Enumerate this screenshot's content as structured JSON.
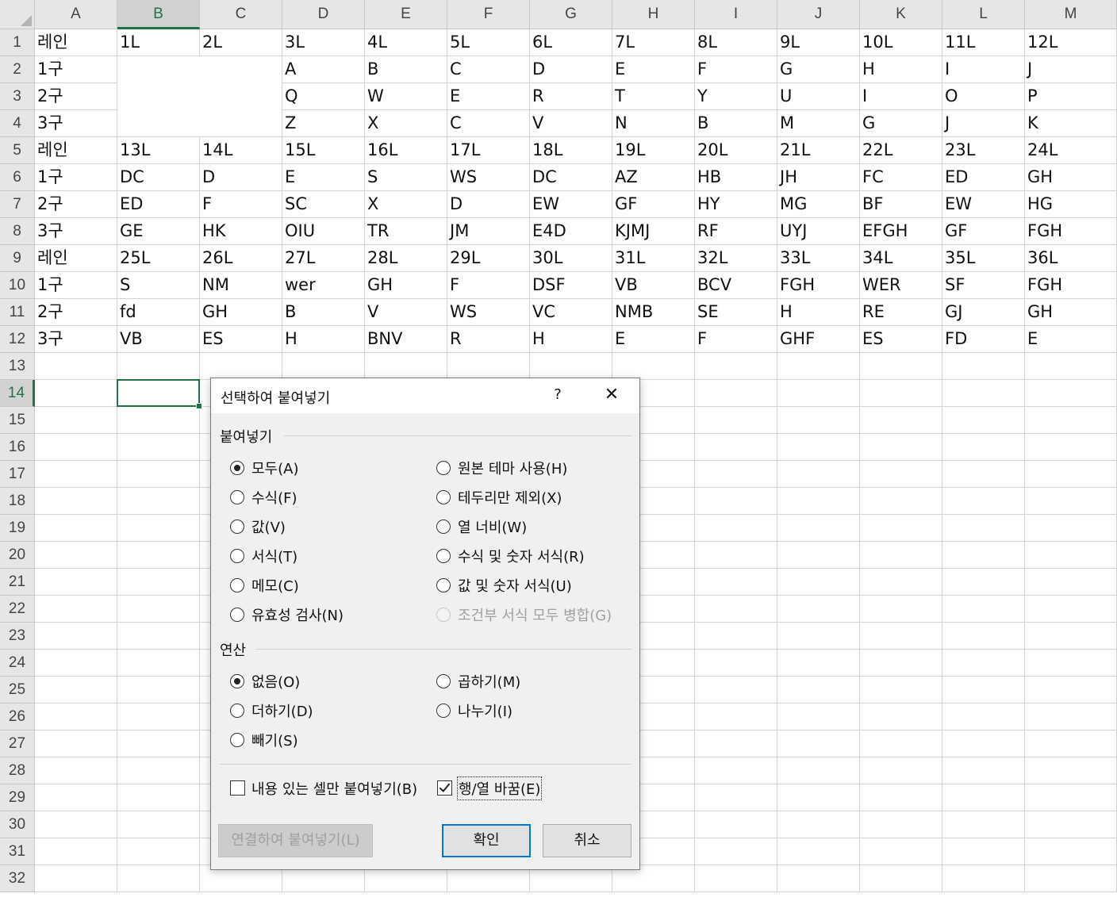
{
  "sheet": {
    "columns": [
      "A",
      "B",
      "C",
      "D",
      "E",
      "F",
      "G",
      "H",
      "I",
      "J",
      "K",
      "L",
      "M"
    ],
    "rows": [
      "1",
      "2",
      "3",
      "4",
      "5",
      "6",
      "7",
      "8",
      "9",
      "10",
      "11",
      "12",
      "13",
      "14",
      "15",
      "16",
      "17",
      "18",
      "19",
      "20",
      "21",
      "22",
      "23",
      "24",
      "25",
      "26",
      "27",
      "28",
      "29",
      "30",
      "31",
      "32"
    ],
    "selected_column": "B",
    "selected_row": "14",
    "cells": [
      [
        "레인",
        "1L",
        "2L",
        "3L",
        "4L",
        "5L",
        "6L",
        "7L",
        "8L",
        "9L",
        "10L",
        "11L",
        "12L"
      ],
      [
        "1구",
        "",
        "",
        "A",
        "B",
        "C",
        "D",
        "E",
        "F",
        "G",
        "H",
        "I",
        "J"
      ],
      [
        "2구",
        "",
        "",
        "Q",
        "W",
        "E",
        "R",
        "T",
        "Y",
        "U",
        "I",
        "O",
        "P"
      ],
      [
        "3구",
        "",
        "",
        "Z",
        "X",
        "C",
        "V",
        "N",
        "B",
        "M",
        "G",
        "J",
        "K"
      ],
      [
        "레인",
        "13L",
        "14L",
        "15L",
        "16L",
        "17L",
        "18L",
        "19L",
        "20L",
        "21L",
        "22L",
        "23L",
        "24L"
      ],
      [
        "1구",
        "DC",
        "D",
        "E",
        "S",
        "WS",
        "DC",
        "AZ",
        "HB",
        "JH",
        "FC",
        "ED",
        "GH"
      ],
      [
        "2구",
        "ED",
        "F",
        "SC",
        "X",
        "D",
        "EW",
        "GF",
        "HY",
        "MG",
        "BF",
        "EW",
        "HG"
      ],
      [
        "3구",
        "GE",
        "HK",
        "OIU",
        "TR",
        "JM",
        "E4D",
        "KJMJ",
        "RF",
        "UYJ",
        "EFGH",
        "GF",
        "FGH"
      ],
      [
        "레인",
        "25L",
        "26L",
        "27L",
        "28L",
        "29L",
        "30L",
        "31L",
        "32L",
        "33L",
        "34L",
        "35L",
        "36L"
      ],
      [
        "1구",
        "S",
        "NM",
        "wer",
        "GH",
        "F",
        "DSF",
        "VB",
        "BCV",
        "FGH",
        "WER",
        "SF",
        "FGH"
      ],
      [
        "2구",
        "fd",
        "GH",
        "B",
        "V",
        "WS",
        "VC",
        "NMB",
        "SE",
        "H",
        "RE",
        "GJ",
        "GH"
      ],
      [
        "3구",
        "VB",
        "ES",
        "H",
        "BNV",
        "R",
        "H",
        "E",
        "F",
        "GHF",
        "ES",
        "FD",
        "E"
      ]
    ]
  },
  "dialog": {
    "title": "선택하여 붙여넣기",
    "help": "?",
    "close": "✕",
    "paste_group": {
      "label": "붙여넣기",
      "options": [
        {
          "label": "모두(A)",
          "selected": true,
          "disabled": false
        },
        {
          "label": "수식(F)",
          "selected": false,
          "disabled": false
        },
        {
          "label": "값(V)",
          "selected": false,
          "disabled": false
        },
        {
          "label": "서식(T)",
          "selected": false,
          "disabled": false
        },
        {
          "label": "메모(C)",
          "selected": false,
          "disabled": false
        },
        {
          "label": "유효성 검사(N)",
          "selected": false,
          "disabled": false
        },
        {
          "label": "원본 테마 사용(H)",
          "selected": false,
          "disabled": false
        },
        {
          "label": "테두리만 제외(X)",
          "selected": false,
          "disabled": false
        },
        {
          "label": "열 너비(W)",
          "selected": false,
          "disabled": false
        },
        {
          "label": "수식 및 숫자 서식(R)",
          "selected": false,
          "disabled": false
        },
        {
          "label": "값 및 숫자 서식(U)",
          "selected": false,
          "disabled": false
        },
        {
          "label": "조건부 서식 모두 병합(G)",
          "selected": false,
          "disabled": true
        }
      ]
    },
    "operation_group": {
      "label": "연산",
      "options": [
        {
          "label": "없음(O)",
          "selected": true
        },
        {
          "label": "더하기(D)",
          "selected": false
        },
        {
          "label": "빼기(S)",
          "selected": false
        },
        {
          "label": "곱하기(M)",
          "selected": false
        },
        {
          "label": "나누기(I)",
          "selected": false
        }
      ]
    },
    "skip_blanks": {
      "label": "내용 있는 셀만 붙여넣기(B)",
      "checked": false
    },
    "transpose": {
      "label": "행/열 바꿈(E)",
      "checked": true
    },
    "paste_link_button": "연결하여 붙여넣기(L)",
    "ok_button": "확인",
    "cancel_button": "취소"
  }
}
